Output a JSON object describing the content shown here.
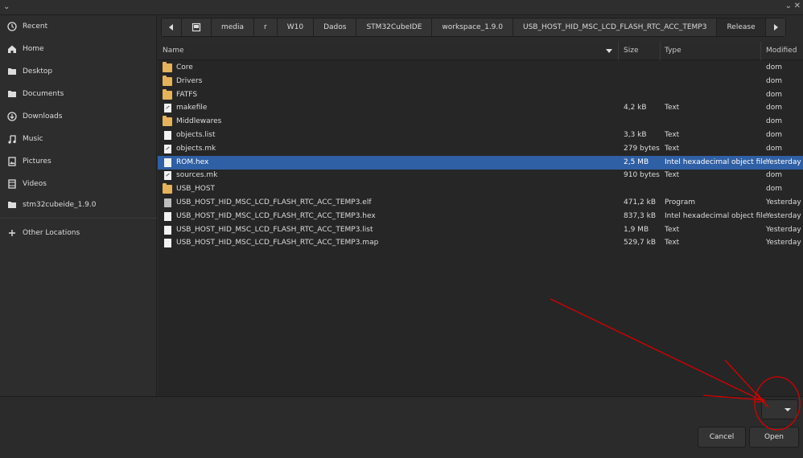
{
  "sidebar": {
    "items": [
      {
        "label": "Recent",
        "icon": "clock-icon"
      },
      {
        "label": "Home",
        "icon": "home-icon"
      },
      {
        "label": "Desktop",
        "icon": "desktop-folder-icon"
      },
      {
        "label": "Documents",
        "icon": "documents-folder-icon"
      },
      {
        "label": "Downloads",
        "icon": "download-icon"
      },
      {
        "label": "Music",
        "icon": "music-icon"
      },
      {
        "label": "Pictures",
        "icon": "pictures-icon"
      },
      {
        "label": "Videos",
        "icon": "videos-icon"
      },
      {
        "label": "stm32cubeide_1.9.0",
        "icon": "folder-icon"
      },
      {
        "label": "Other Locations",
        "icon": "plus-icon"
      }
    ]
  },
  "pathbar": {
    "crumbs": [
      "media",
      "r",
      "W10",
      "Dados",
      "STM32CubeIDE",
      "workspace_1.9.0",
      "USB_HOST_HID_MSC_LCD_FLASH_RTC_ACC_TEMP3",
      "Release"
    ]
  },
  "columns": {
    "name": "Name",
    "size": "Size",
    "type": "Type",
    "modified": "Modified"
  },
  "files": [
    {
      "name": "Core",
      "size": "",
      "type": "",
      "modified": "dom",
      "kind": "folder"
    },
    {
      "name": "Drivers",
      "size": "",
      "type": "",
      "modified": "dom",
      "kind": "folder"
    },
    {
      "name": "FATFS",
      "size": "",
      "type": "",
      "modified": "dom",
      "kind": "folder"
    },
    {
      "name": "makefile",
      "size": "4,2 kB",
      "type": "Text",
      "modified": "dom",
      "kind": "script"
    },
    {
      "name": "Middlewares",
      "size": "",
      "type": "",
      "modified": "dom",
      "kind": "folder"
    },
    {
      "name": "objects.list",
      "size": "3,3 kB",
      "type": "Text",
      "modified": "dom",
      "kind": "doc"
    },
    {
      "name": "objects.mk",
      "size": "279 bytes",
      "type": "Text",
      "modified": "dom",
      "kind": "script"
    },
    {
      "name": "ROM.hex",
      "size": "2,5 MB",
      "type": "Intel hexadecimal object file",
      "modified": "Yesterday",
      "kind": "doc",
      "selected": true
    },
    {
      "name": "sources.mk",
      "size": "910 bytes",
      "type": "Text",
      "modified": "dom",
      "kind": "script"
    },
    {
      "name": "USB_HOST",
      "size": "",
      "type": "",
      "modified": "dom",
      "kind": "folder"
    },
    {
      "name": "USB_HOST_HID_MSC_LCD_FLASH_RTC_ACC_TEMP3.elf",
      "size": "471,2 kB",
      "type": "Program",
      "modified": "Yesterday",
      "kind": "exe"
    },
    {
      "name": "USB_HOST_HID_MSC_LCD_FLASH_RTC_ACC_TEMP3.hex",
      "size": "837,3 kB",
      "type": "Intel hexadecimal object file",
      "modified": "Yesterday",
      "kind": "doc"
    },
    {
      "name": "USB_HOST_HID_MSC_LCD_FLASH_RTC_ACC_TEMP3.list",
      "size": "1,9 MB",
      "type": "Text",
      "modified": "Yesterday",
      "kind": "doc"
    },
    {
      "name": "USB_HOST_HID_MSC_LCD_FLASH_RTC_ACC_TEMP3.map",
      "size": "529,7 kB",
      "type": "Text",
      "modified": "Yesterday",
      "kind": "doc"
    }
  ],
  "footer": {
    "cancel_label": "Cancel",
    "open_label": "Open"
  },
  "colors": {
    "selection": "#2f5fa4",
    "annotation": "#d40000",
    "folder": "#e6b35a"
  }
}
